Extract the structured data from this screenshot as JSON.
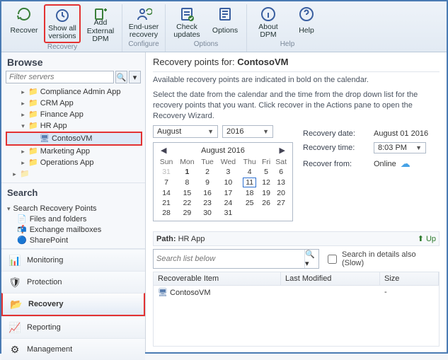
{
  "ribbon": {
    "groups": [
      {
        "label": "Recovery",
        "buttons": [
          {
            "id": "recover",
            "label": "Recover",
            "icon": "recover-icon"
          },
          {
            "id": "show-versions",
            "label": "Show all\nversions",
            "icon": "clock-icon",
            "highlighted": true
          },
          {
            "id": "add-dpm",
            "label": "Add External\nDPM",
            "icon": "server-add-icon"
          }
        ]
      },
      {
        "label": "Configure",
        "buttons": [
          {
            "id": "enduser",
            "label": "End-user\nrecovery",
            "icon": "user-recover-icon"
          }
        ]
      },
      {
        "label": "Options",
        "buttons": [
          {
            "id": "check-updates",
            "label": "Check\nupdates",
            "icon": "updates-icon"
          },
          {
            "id": "options",
            "label": "Options",
            "icon": "options-icon"
          }
        ]
      },
      {
        "label": "Help",
        "buttons": [
          {
            "id": "about",
            "label": "About\nDPM",
            "icon": "about-icon"
          },
          {
            "id": "help",
            "label": "Help",
            "icon": "help-icon"
          }
        ]
      }
    ]
  },
  "browse": {
    "title": "Browse",
    "filter_placeholder": "Filter servers",
    "tree": [
      {
        "level": 2,
        "exp": "▸",
        "label": "Compliance Admin App"
      },
      {
        "level": 2,
        "exp": "▸",
        "label": "CRM App"
      },
      {
        "level": 2,
        "exp": "▸",
        "label": "Finance App"
      },
      {
        "level": 2,
        "exp": "▾",
        "label": "HR App"
      },
      {
        "level": 3,
        "exp": "",
        "label": "ContosoVM",
        "selected": true,
        "highlighted": true,
        "icon": "vm"
      },
      {
        "level": 2,
        "exp": "▸",
        "label": "Marketing App"
      },
      {
        "level": 2,
        "exp": "▸",
        "label": "Operations App"
      },
      {
        "level": 1,
        "exp": "▸",
        "label": "",
        "dim": true
      }
    ]
  },
  "search": {
    "title": "Search",
    "group": "Search Recovery Points",
    "items": [
      {
        "label": "Files and folders",
        "icon": "files-icon"
      },
      {
        "label": "Exchange mailboxes",
        "icon": "mailboxes-icon"
      },
      {
        "label": "SharePoint",
        "icon": "sharepoint-icon"
      }
    ]
  },
  "nav": [
    {
      "id": "monitoring",
      "label": "Monitoring",
      "icon": "monitoring-icon"
    },
    {
      "id": "protection",
      "label": "Protection",
      "icon": "protection-icon"
    },
    {
      "id": "recovery",
      "label": "Recovery",
      "icon": "recovery-icon",
      "active": true,
      "highlighted": true
    },
    {
      "id": "reporting",
      "label": "Reporting",
      "icon": "reporting-icon"
    },
    {
      "id": "management",
      "label": "Management",
      "icon": "management-icon"
    }
  ],
  "main": {
    "title_prefix": "Recovery points for:",
    "title_target": "ContosoVM",
    "desc1": "Available recovery points are indicated in bold on the calendar.",
    "desc2": "Select the date from the calendar and the time from the drop down list for the recovery points that you want. Click recover in the Actions pane to open the Recovery Wizard.",
    "month_dd": "August",
    "year_dd": "2016",
    "info": {
      "recovery_date_label": "Recovery date:",
      "recovery_date": "August 01 2016",
      "recovery_time_label": "Recovery time:",
      "recovery_time": "8:03 PM",
      "recover_from_label": "Recover from:",
      "recover_from": "Online"
    },
    "calendar": {
      "header": "August 2016",
      "dow": [
        "Sun",
        "Mon",
        "Tue",
        "Wed",
        "Thu",
        "Fri",
        "Sat"
      ],
      "weeks": [
        [
          {
            "d": 31,
            "out": true
          },
          {
            "d": 1,
            "bold": true
          },
          {
            "d": 2
          },
          {
            "d": 3
          },
          {
            "d": 4
          },
          {
            "d": 5
          },
          {
            "d": 6
          }
        ],
        [
          {
            "d": 7
          },
          {
            "d": 8
          },
          {
            "d": 9
          },
          {
            "d": 10
          },
          {
            "d": 11,
            "today": true
          },
          {
            "d": 12
          },
          {
            "d": 13
          }
        ],
        [
          {
            "d": 14
          },
          {
            "d": 15
          },
          {
            "d": 16
          },
          {
            "d": 17
          },
          {
            "d": 18
          },
          {
            "d": 19
          },
          {
            "d": 20
          }
        ],
        [
          {
            "d": 21
          },
          {
            "d": 22
          },
          {
            "d": 23
          },
          {
            "d": 24
          },
          {
            "d": 25
          },
          {
            "d": 26
          },
          {
            "d": 27
          }
        ],
        [
          {
            "d": 28
          },
          {
            "d": 29
          },
          {
            "d": 30
          },
          {
            "d": 31
          },
          {
            "d": ""
          },
          {
            "d": ""
          },
          {
            "d": ""
          }
        ]
      ]
    },
    "path_label": "Path:",
    "path_value": "HR App",
    "up_label": "Up",
    "search_placeholder": "Search list below",
    "search_details_label": "Search in details also (Slow)",
    "grid": {
      "cols": [
        "Recoverable Item",
        "Last Modified",
        "Size"
      ],
      "rows": [
        {
          "item": "ContosoVM",
          "modified": "",
          "size": "-"
        }
      ]
    }
  }
}
